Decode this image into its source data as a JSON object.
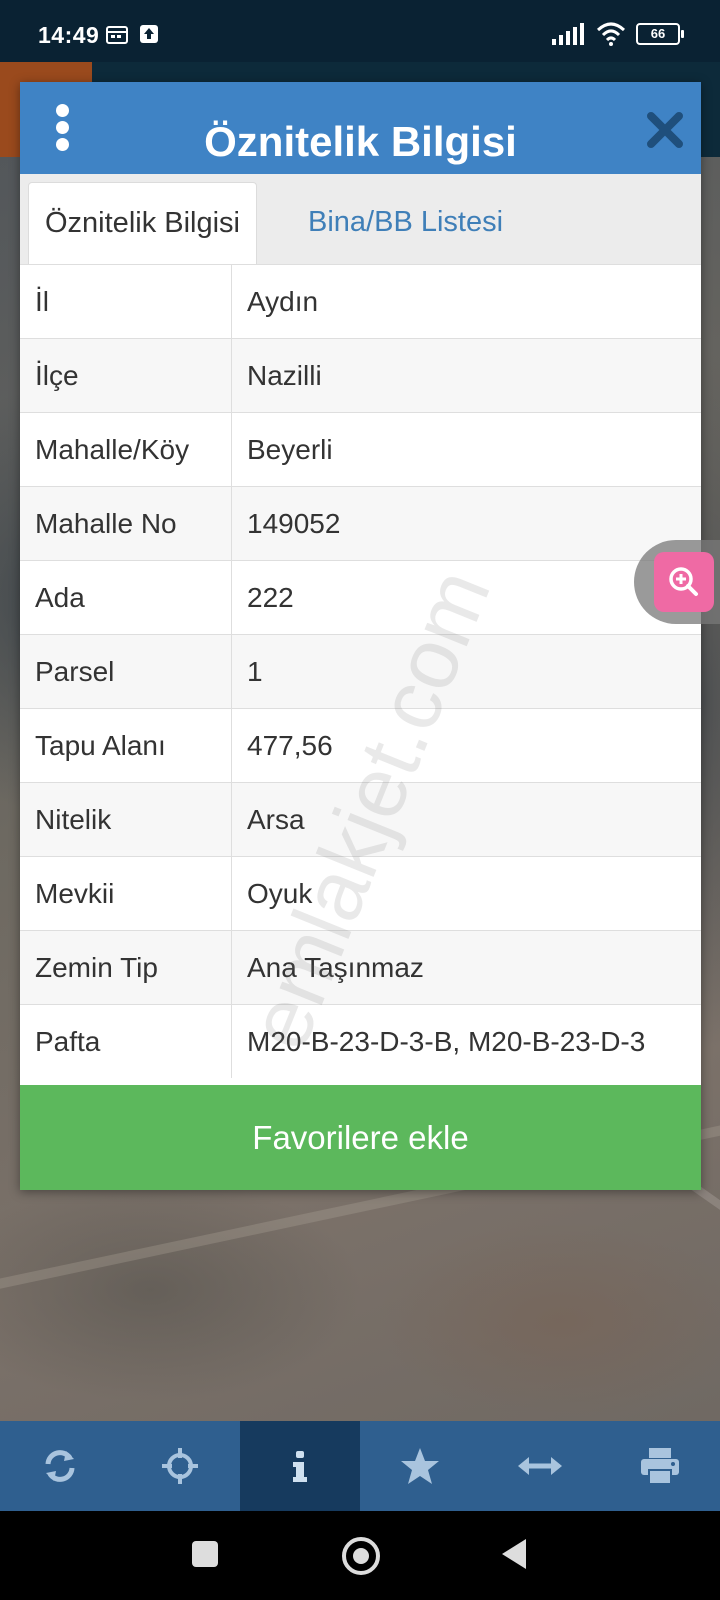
{
  "status_bar": {
    "time": "14:49",
    "battery": "66"
  },
  "dialog": {
    "title": "Öznitelik Bilgisi",
    "tabs": [
      {
        "label": "Öznitelik Bilgisi",
        "active": true
      },
      {
        "label": "Bina/BB Listesi",
        "active": false
      }
    ],
    "rows": [
      {
        "key": "İl",
        "value": "Aydın"
      },
      {
        "key": "İlçe",
        "value": "Nazilli"
      },
      {
        "key": "Mahalle/Köy",
        "value": "Beyerli"
      },
      {
        "key": "Mahalle No",
        "value": "149052"
      },
      {
        "key": "Ada",
        "value": "222"
      },
      {
        "key": "Parsel",
        "value": "1"
      },
      {
        "key": "Tapu Alanı",
        "value": "477,56"
      },
      {
        "key": "Nitelik",
        "value": "Arsa"
      },
      {
        "key": "Mevkii",
        "value": "Oyuk"
      },
      {
        "key": "Zemin Tip",
        "value": "Ana Taşınmaz"
      },
      {
        "key": "Pafta",
        "value": "M20-B-23-D-3-B, M20-B-23-D-3"
      }
    ],
    "favorite_button": "Favorilere ekle"
  },
  "watermark": "emlakjet.com",
  "toolbar": {
    "items": [
      {
        "icon": "refresh-icon"
      },
      {
        "icon": "crosshair-icon"
      },
      {
        "icon": "info-icon",
        "active": true
      },
      {
        "icon": "star-icon"
      },
      {
        "icon": "arrows-horizontal-icon"
      },
      {
        "icon": "print-icon"
      }
    ]
  },
  "colors": {
    "header": "#3f83c5",
    "tab_link": "#3f7fb8",
    "favorite_button": "#5cb85c",
    "toolbar": "#2f5f8f",
    "toolbar_active": "#163a5e",
    "zoom_button": "#ef6aa4"
  }
}
